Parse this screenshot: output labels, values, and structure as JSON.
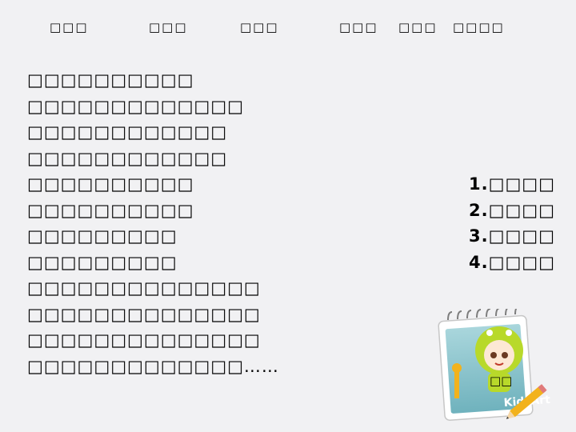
{
  "nav": {
    "items": [
      {
        "label": "□□□"
      },
      {
        "label": "□□□"
      },
      {
        "label": "□□□"
      },
      {
        "label": "□□□"
      },
      {
        "label": "□□□"
      },
      {
        "label": "□□□□"
      }
    ]
  },
  "content": {
    "lines": [
      "□□□□□□□□□□",
      "□□□□□□□□□□□□□",
      "□□□□□□□□□□□□",
      "□□□□□□□□□□□□",
      "□□□□□□□□□□",
      "□□□□□□□□□□",
      "□□□□□□□□□",
      "□□□□□□□□□",
      "□□□□□□□□□□□□□□",
      "□□□□□□□□□□□□□□",
      "□□□□□□□□□□□□□□",
      "□□□□□□□□□□□□□……"
    ],
    "numbered": [
      "1.□□□□",
      "2.□□□□",
      "3.□□□□",
      "4.□□□□"
    ]
  },
  "illustration": {
    "label": "□□",
    "icon": "notebook-with-cartoon-kid-and-pencil-icon",
    "logo_text": "KidzArt"
  },
  "colors": {
    "background": "#f1f1f3",
    "text": "#000000",
    "notebook_cover": "#8fc5cc",
    "character_green": "#b8d92a",
    "pencil": "#f2b21c"
  }
}
